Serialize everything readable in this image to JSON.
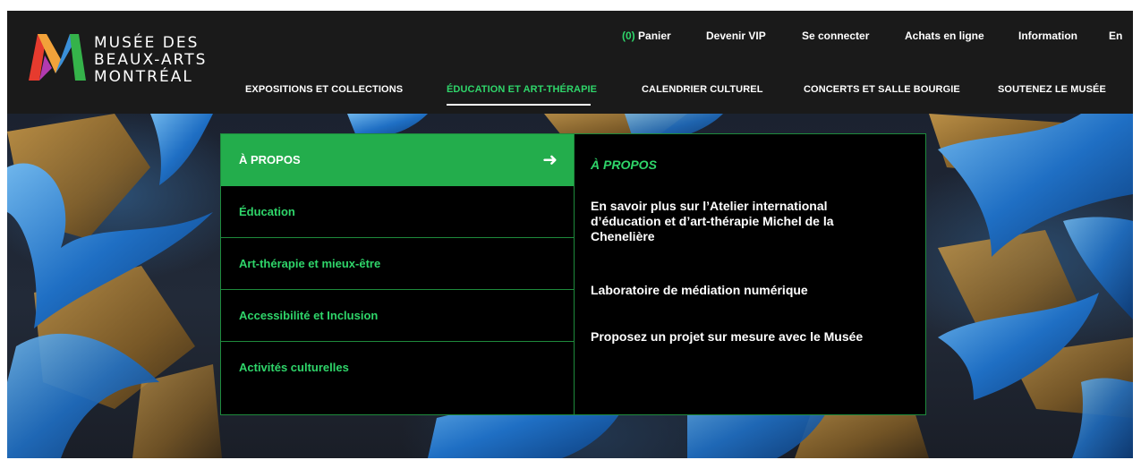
{
  "brand": {
    "logo_lines": [
      "MUSÉE DES",
      "BEAUX-ARTS",
      "MONTRÉAL"
    ]
  },
  "utility_nav": {
    "cart_count": "(0)",
    "cart_label": "Panier",
    "vip": "Devenir VIP",
    "login": "Se connecter",
    "shop": "Achats en ligne",
    "info": "Information",
    "language": "En"
  },
  "main_nav": {
    "items": [
      {
        "label": "EXPOSITIONS ET COLLECTIONS"
      },
      {
        "label": "ÉDUCATION ET ART-THÉRAPIE",
        "active": true
      },
      {
        "label": "CALENDRIER CULTUREL"
      },
      {
        "label": "CONCERTS ET SALLE BOURGIE"
      },
      {
        "label": "SOUTENEZ LE MUSÉE"
      }
    ]
  },
  "mega_menu": {
    "left_items": [
      {
        "label": "À PROPOS",
        "active": true
      },
      {
        "label": "Éducation"
      },
      {
        "label": "Art-thérapie et mieux-être"
      },
      {
        "label": "Accessibilité et Inclusion"
      },
      {
        "label": "Activités culturelles"
      }
    ],
    "arrow_icon": "arrow-right-icon",
    "right": {
      "title": "À PROPOS",
      "links": [
        "En savoir plus sur l’Atelier international d’éducation et d’art-thérapie Michel de la Chenelière",
        "Laboratoire de médiation numérique",
        "Proposez un projet sur mesure avec le Musée"
      ]
    }
  },
  "colors": {
    "accent_green": "#23ad4c",
    "text_green": "#2fd56a",
    "header_bg": "#1a1a1a",
    "menu_bg": "#000000"
  }
}
